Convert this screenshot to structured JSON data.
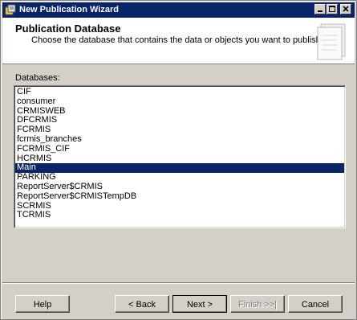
{
  "window": {
    "title": "New Publication Wizard",
    "buttons": [
      "minimize-icon",
      "maximize-icon",
      "close-icon"
    ]
  },
  "header": {
    "title": "Publication Database",
    "subtitle": "Choose the database that contains the data or objects you want to publish."
  },
  "databases": {
    "label": "Databases:",
    "items": [
      "CIF",
      "consumer",
      "CRMISWEB",
      "DFCRMIS",
      "FCRMIS",
      "fcrmis_branches",
      "FCRMIS_CIF",
      "HCRMIS",
      "Main",
      "PARKING",
      "ReportServer$CRMIS",
      "ReportServer$CRMISTempDB",
      "SCRMIS",
      "TCRMIS"
    ],
    "selected": "Main"
  },
  "footer": {
    "help": "Help",
    "back": "< Back",
    "next": "Next >",
    "finish": "Finish >>|",
    "cancel": "Cancel"
  },
  "colors": {
    "titlebar": "#0a246a",
    "selection": "#0a246a",
    "face": "#d4d0c8"
  }
}
